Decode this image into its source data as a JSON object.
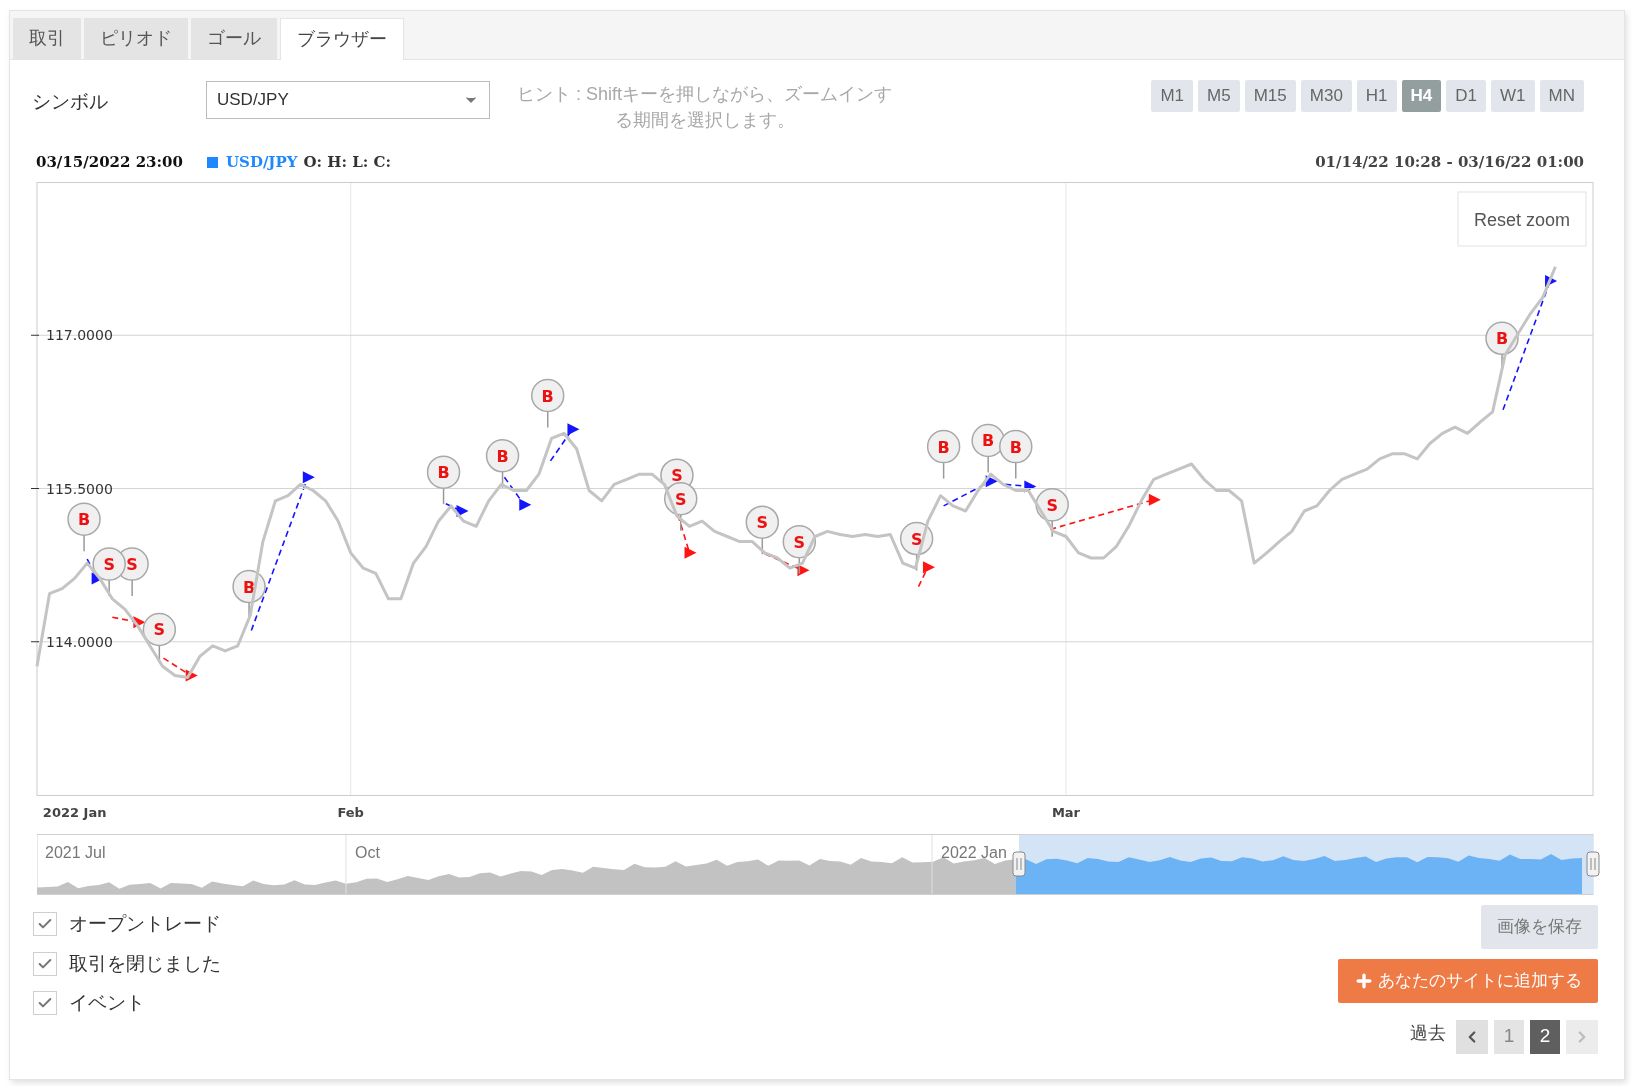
{
  "tabs": [
    {
      "label": "取引",
      "selected": false
    },
    {
      "label": "ピリオド",
      "selected": false
    },
    {
      "label": "ゴール",
      "selected": false
    },
    {
      "label": "ブラウザー",
      "selected": true
    }
  ],
  "symbol": {
    "label": "シンボル",
    "value": "USD/JPY"
  },
  "hint": "ヒント : Shiftキーを押しながら、ズームインする期間を選択します。",
  "timeframes": [
    {
      "label": "M1",
      "selected": false
    },
    {
      "label": "M5",
      "selected": false
    },
    {
      "label": "M15",
      "selected": false
    },
    {
      "label": "M30",
      "selected": false
    },
    {
      "label": "H1",
      "selected": false
    },
    {
      "label": "H4",
      "selected": true
    },
    {
      "label": "D1",
      "selected": false
    },
    {
      "label": "W1",
      "selected": false
    },
    {
      "label": "MN",
      "selected": false
    }
  ],
  "chart": {
    "timestamp": "03/15/2022 23:00",
    "legend": {
      "ohlc": "O: H: L: C:",
      "color": "#1e88ff"
    },
    "range": "01/14/22 10:28 - 03/16/22 01:00",
    "reset_zoom": "Reset zoom",
    "chart_data": {
      "type": "line",
      "grid": true,
      "ylim": [
        112.5,
        118.5
      ],
      "categories": [
        null,
        null,
        null,
        "2022 Jan",
        null,
        null,
        null,
        null,
        null,
        null,
        null,
        null,
        null,
        null,
        null,
        null,
        null,
        null,
        null,
        null,
        null,
        null,
        null,
        null,
        null,
        "Feb",
        null,
        null,
        null,
        null,
        null,
        null,
        null,
        null,
        null,
        null,
        null,
        null,
        null,
        null,
        null,
        null,
        null,
        null,
        null,
        null,
        null,
        null,
        null,
        null,
        null,
        null,
        null,
        null,
        null,
        null,
        null,
        null,
        null,
        null,
        null,
        null,
        null,
        null,
        null,
        null,
        null,
        null,
        null,
        null,
        null,
        null,
        null,
        null,
        null,
        null,
        null,
        null,
        null,
        null,
        null,
        null,
        "Mar",
        null,
        null,
        null,
        null,
        null,
        null,
        null,
        null,
        null,
        null,
        null,
        null,
        null,
        null,
        null,
        null,
        null,
        null,
        null,
        null,
        null,
        null,
        null,
        null,
        null,
        null,
        null,
        null,
        null,
        null,
        null,
        null,
        null,
        null,
        null,
        null,
        null,
        null,
        null,
        null,
        null,
        null
      ],
      "yticks": [
        {
          "value": 114,
          "label": "114.0000"
        },
        {
          "value": 115.5,
          "label": "115.5000"
        },
        {
          "value": 117,
          "label": "117.0000"
        }
      ],
      "series": [
        {
          "name": "USD/JPY",
          "color": "#c4c4c4",
          "values": [
            113.76,
            114.47,
            114.52,
            114.62,
            114.77,
            114.62,
            114.42,
            114.32,
            114.16,
            113.96,
            113.76,
            113.67,
            113.65,
            113.86,
            113.96,
            113.91,
            113.96,
            114.26,
            114.98,
            115.38,
            115.43,
            115.54,
            115.48,
            115.38,
            115.18,
            114.87,
            114.72,
            114.67,
            114.42,
            114.42,
            114.77,
            114.93,
            115.18,
            115.33,
            115.18,
            115.13,
            115.38,
            115.54,
            115.48,
            115.48,
            115.64,
            115.99,
            116.04,
            115.89,
            115.48,
            115.38,
            115.54,
            115.59,
            115.64,
            115.64,
            115.54,
            115.23,
            115.13,
            115.18,
            115.08,
            115.03,
            114.98,
            114.98,
            114.87,
            114.82,
            114.72,
            114.77,
            115.03,
            115.08,
            115.05,
            115.03,
            115.05,
            115.03,
            115.05,
            114.77,
            114.72,
            115.18,
            115.43,
            115.33,
            115.28,
            115.48,
            115.64,
            115.54,
            115.48,
            115.48,
            115.28,
            115.08,
            115.03,
            114.87,
            114.82,
            114.82,
            114.93,
            115.13,
            115.38,
            115.59,
            115.64,
            115.69,
            115.74,
            115.59,
            115.48,
            115.48,
            115.38,
            114.77,
            114.87,
            114.98,
            115.08,
            115.28,
            115.33,
            115.48,
            115.59,
            115.64,
            115.69,
            115.79,
            115.84,
            115.84,
            115.79,
            115.94,
            116.04,
            116.1,
            116.04,
            116.15,
            116.25,
            116.81,
            117.01,
            117.21,
            117.37,
            117.67,
            null,
            null,
            null
          ]
        }
      ]
    },
    "trade_markers": [
      {
        "label": "B"
      },
      {
        "label": "S"
      },
      {
        "label": "S"
      },
      {
        "label": "S"
      },
      {
        "label": "B"
      },
      {
        "label": "B"
      },
      {
        "label": "B"
      },
      {
        "label": "B"
      },
      {
        "label": "S"
      },
      {
        "label": "S"
      },
      {
        "label": "S"
      },
      {
        "label": "S"
      },
      {
        "label": "S"
      },
      {
        "label": "B"
      },
      {
        "label": "B"
      },
      {
        "label": "B"
      },
      {
        "label": "S"
      },
      {
        "label": "B"
      }
    ]
  },
  "navigator": {
    "labels": [
      "2021 Jul",
      "Oct",
      "2022 Jan"
    ]
  },
  "options": [
    {
      "label": "オープントレード",
      "checked": true
    },
    {
      "label": "取引を閉じました",
      "checked": true
    },
    {
      "label": "イベント",
      "checked": true
    }
  ],
  "save_image": "画像を保存",
  "add_to_site": "あなたのサイトに追加する",
  "pagination": {
    "label": "過去",
    "prev": {
      "disabled": false
    },
    "pages": [
      {
        "label": "1",
        "selected": false
      },
      {
        "label": "2",
        "selected": true
      }
    ],
    "next": {
      "disabled": true
    }
  }
}
